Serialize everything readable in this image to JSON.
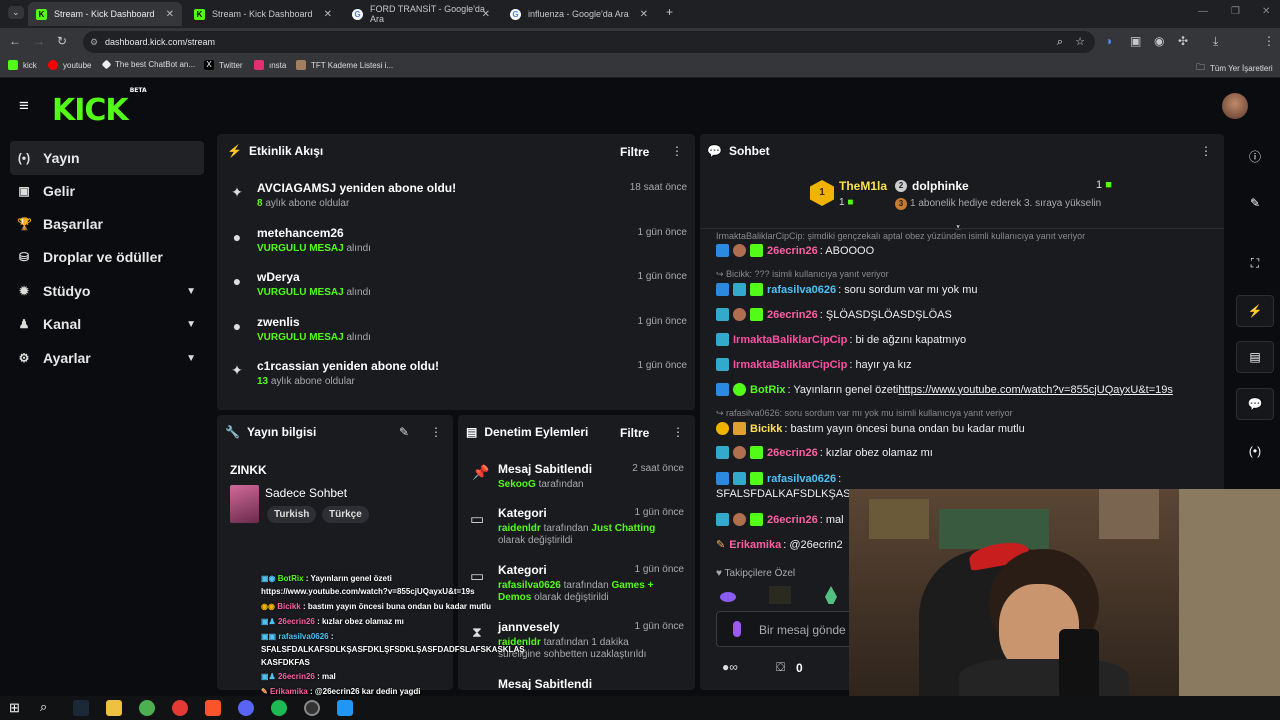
{
  "browser": {
    "tabs": [
      {
        "title": "Stream - Kick Dashboard",
        "active": true
      },
      {
        "title": "Stream - Kick Dashboard",
        "active": false
      },
      {
        "title": "FORD TRANSİT - Google'da Ara",
        "active": false
      },
      {
        "title": "influenza - Google'da Ara",
        "active": false
      }
    ],
    "url": "dashboard.kick.com/stream",
    "bookmarks": [
      "kick",
      "youtube",
      "The best ChatBot an...",
      "Twitter",
      "ınsta",
      "TFT Kademe Listesi i..."
    ],
    "all_bookmarks_label": "Tüm Yer İşaretleri"
  },
  "header": {
    "logo": "KICK",
    "beta": "BETA"
  },
  "sidebar": {
    "items": [
      {
        "label": "Yayın",
        "icon": "broadcast-icon",
        "glyph": "(•)",
        "active": true,
        "expand": false
      },
      {
        "label": "Gelir",
        "icon": "revenue-icon",
        "glyph": "▣",
        "active": false,
        "expand": false
      },
      {
        "label": "Başarılar",
        "icon": "trophy-icon",
        "glyph": "🏆",
        "active": false,
        "expand": false
      },
      {
        "label": "Droplar ve ödüller",
        "icon": "gift-icon",
        "glyph": "⛁",
        "active": false,
        "expand": false
      },
      {
        "label": "Stüdyo",
        "icon": "gear-icon",
        "glyph": "✹",
        "active": false,
        "expand": true
      },
      {
        "label": "Kanal",
        "icon": "user-icon",
        "glyph": "♟",
        "active": false,
        "expand": true
      },
      {
        "label": "Ayarlar",
        "icon": "settings-icon",
        "glyph": "⚙",
        "active": false,
        "expand": true
      }
    ]
  },
  "activity": {
    "title": "Etkinlik Akışı",
    "filter": "Filtre",
    "items": [
      {
        "name": "AVCIAGAMSJ yeniden abone oldu!",
        "hl": "8",
        "sub": " aylık abone oldular",
        "time": "18 saat önce",
        "icon": "sparkle-icon"
      },
      {
        "name": "metehancem26",
        "hl": "VURGULU MESAJ",
        "sub": " alındı",
        "time": "1 gün önce",
        "icon": "kicks-icon"
      },
      {
        "name": "wDerya",
        "hl": "VURGULU MESAJ",
        "sub": " alındı",
        "time": "1 gün önce",
        "icon": "kicks-icon"
      },
      {
        "name": "zwenlis",
        "hl": "VURGULU MESAJ",
        "sub": " alındı",
        "time": "1 gün önce",
        "icon": "kicks-icon"
      },
      {
        "name": "c1rcassian yeniden abone oldu!",
        "hl": "13",
        "sub": " aylık abone oldular",
        "time": "1 gün önce",
        "icon": "sparkle-icon"
      }
    ]
  },
  "stream_info": {
    "title": "Yayın bilgisi",
    "stream_title": "ZINKK",
    "category": "Sadece Sohbet",
    "tags": [
      "Turkish",
      "Türkçe"
    ]
  },
  "moderation": {
    "title": "Denetim Eylemleri",
    "filter": "Filtre",
    "items": [
      {
        "title": "Mesaj Sabitlendi",
        "time": "2 saat önce",
        "actor": "SekooG",
        "text": " tarafından",
        "extra": "",
        "text2": "",
        "icon": "pin-icon"
      },
      {
        "title": "Kategori",
        "time": "1 gün önce",
        "actor": "raidenldr",
        "text": " tarafından ",
        "extra": "Just Chatting",
        "text2": "olarak değiştirildi",
        "icon": "category-icon"
      },
      {
        "title": "Kategori",
        "time": "1 gün önce",
        "actor": "rafasilva0626",
        "text": " tarafından ",
        "extra": "Games + Demos",
        "text2": " olarak değiştirildi",
        "icon": "category-icon"
      },
      {
        "title": "jannvesely",
        "time": "1 gün önce",
        "actor": "raidenldr",
        "text": " tarafından 1 dakika",
        "extra": "",
        "text2": "süreliğine sohbetten uzaklaştırıldı",
        "icon": "hourglass-icon"
      },
      {
        "title": "Mesaj Sabitlendi",
        "time": "",
        "actor": "",
        "text": "",
        "extra": "",
        "text2": "",
        "icon": "pin-icon"
      }
    ]
  },
  "chat": {
    "title": "Sohbet",
    "leader1": {
      "name": "TheM1la",
      "rank": "1",
      "count": "1"
    },
    "leader2": {
      "name": "dolphinke",
      "rank": "2",
      "count": "1",
      "sub": "1 abonelik hediye ederek 3. sıraya yükselin"
    },
    "truncated_reply": "IrmaktaBaliklarCipCip: şimdiki gençzekalı aptal obez yüzünden isimli kullanıcıya yanıt veriyor",
    "messages": [
      {
        "user": "26ecrin26",
        "color": "#ff5fa2",
        "text": ": ABOOOO",
        "reply": ""
      },
      {
        "user": "rafasilva0626",
        "color": "#4fc3f7",
        "text": ": soru sordum var mı yok mu",
        "reply": "Bicikk: ??? isimli kullanıcıya yanıt veriyor"
      },
      {
        "user": "26ecrin26",
        "color": "#ff5fa2",
        "text": ": ŞLÖASDŞLÖASDŞLÖAS",
        "reply": ""
      },
      {
        "user": "IrmaktaBaliklarCipCip",
        "color": "#ff4fa3",
        "text": ": bi de ağzını kapatmıyo",
        "reply": ""
      },
      {
        "user": "IrmaktaBaliklarCipCip",
        "color": "#ff4fa3",
        "text": ": hayır ya kız",
        "reply": ""
      },
      {
        "user": "BotRix",
        "color": "#53fc18",
        "text": ": Yayınların genel özeti ",
        "link": "https://www.youtube.com/watch?v=855cjUQayxU&t=19s",
        "reply": ""
      },
      {
        "user": "Bicikk",
        "color": "#ffe14d",
        "text": ": bastım yayın öncesi buna ondan bu kadar mutlu",
        "reply": "rafasilva0626: soru sordum var mı yok mu isimli kullanıcıya yanıt veriyor"
      },
      {
        "user": "26ecrin26",
        "color": "#ff5fa2",
        "text": ": kızlar obez olamaz mı",
        "reply": ""
      },
      {
        "user": "rafasilva0626",
        "color": "#4fc3f7",
        "text": ":",
        "reply": ""
      },
      {
        "user": "26ecrin26",
        "color": "#ff5fa2",
        "text": ": mal",
        "reply": ""
      },
      {
        "user": "Erikamika",
        "color": "#ff5fa2",
        "text": ": @26ecrin2",
        "reply": ""
      }
    ],
    "wrapped_line": "SFALSFDALKAFSDLKŞASI",
    "followers_only": "Takipçilere Özel",
    "input_placeholder": "Bir mesaj gönde",
    "kicks_count": "0"
  },
  "overlay_chat": [
    {
      "user": "BotRix",
      "color": "#53fc18",
      "text": " : Yayınların genel özeti"
    },
    {
      "user": "",
      "color": "#fff",
      "text": "https://www.youtube.com/watch?v=855cjUQayxU&t=19s"
    },
    {
      "user": "Bicikk",
      "color": "#ff5fa2",
      "text": " : bastım yayın öncesi buna ondan bu kadar mutlu"
    },
    {
      "user": "26ecrin26",
      "color": "#ff5fa2",
      "text": " : kızlar obez olamaz mı"
    },
    {
      "user": "rafasilva0626",
      "color": "#4fc3f7",
      "text": " :"
    },
    {
      "user": "",
      "color": "#fff",
      "text": "SFALSFDALKAFSDLKŞASFDKLŞFSDKLŞASFDADFSLAFSKASKLAŞ"
    },
    {
      "user": "",
      "color": "#fff",
      "text": "KASFDKFAS"
    },
    {
      "user": "26ecrin26",
      "color": "#ff5fa2",
      "text": " : mal"
    },
    {
      "user": "Erikamika",
      "color": "#ff5fa2",
      "text": " : @26ecrin26 kar dedin yagdi"
    }
  ],
  "colors": {
    "brand": "#53fc18",
    "panel": "#191b1f",
    "bg": "#0b0c0f"
  }
}
